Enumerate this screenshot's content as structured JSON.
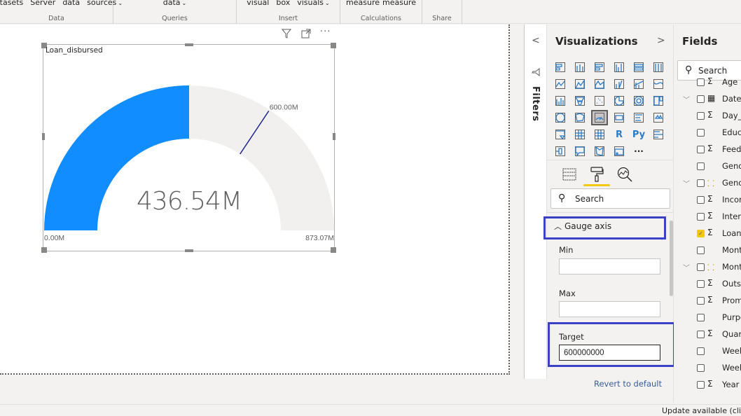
{
  "ribbon": {
    "groups": [
      {
        "label": "Data",
        "buttons": [
          "datasets",
          "Server",
          "data",
          "sources"
        ],
        "dropdown_last": true
      },
      {
        "label": "Queries",
        "buttons": [
          "data"
        ],
        "dropdown_last": true
      },
      {
        "label": "Insert",
        "buttons": [
          "visual",
          "box",
          "visuals"
        ],
        "dropdown_last": true
      },
      {
        "label": "Calculations",
        "buttons": [
          "measure",
          "measure"
        ],
        "dropdown_last": false
      },
      {
        "label": "Share",
        "buttons": [],
        "dropdown_last": false
      }
    ]
  },
  "visual": {
    "title": "Loan_disbursed",
    "header_icons": [
      "filter-icon",
      "focus-mode-icon",
      "more-options-icon"
    ]
  },
  "chart_data": {
    "type": "gauge",
    "title": "Loan_disbursed",
    "value": 436540000,
    "value_label": "436.54M",
    "min": 0,
    "min_label": "0.00M",
    "max": 873070000,
    "max_label": "873.07M",
    "target": 600000000,
    "target_label": "600.00M",
    "colors": {
      "fill": "#118dff",
      "track": "#f1f0ef",
      "target": "#1b2185"
    }
  },
  "filters_pane": {
    "label": "Filters",
    "collapse_glyph": "<"
  },
  "visualizations": {
    "title": "Visualizations",
    "expand_glyph": ">",
    "selected_index": 14,
    "icons": [
      "stacked-bar-chart-icon",
      "stacked-column-chart-icon",
      "clustered-bar-chart-icon",
      "clustered-column-chart-icon",
      "100-stacked-bar-chart-icon",
      "100-stacked-column-chart-icon",
      "line-chart-icon",
      "area-chart-icon",
      "stacked-area-chart-icon",
      "line-and-stacked-column-icon",
      "line-and-clustered-column-icon",
      "ribbon-chart-icon",
      "waterfall-chart-icon",
      "funnel-icon",
      "scatter-chart-icon",
      "pie-chart-icon",
      "donut-chart-icon",
      "treemap-icon",
      "map-icon",
      "filled-map-icon",
      "gauge-icon",
      "card-icon",
      "multi-row-card-icon",
      "kpi-icon",
      "slicer-icon",
      "table-icon",
      "matrix-icon",
      "r-script-visual-icon",
      "python-visual-icon",
      "key-influencers-icon",
      "decomposition-tree-icon",
      "qa-icon",
      "shape-map-icon",
      "arcgis-icon",
      "more-visuals-icon"
    ],
    "pane_tabs": [
      "fields-tab",
      "format-tab",
      "analytics-tab"
    ],
    "active_tab": "format-tab",
    "search_placeholder": "Search",
    "section": {
      "label": "Gauge axis",
      "expanded": true
    },
    "fields": [
      {
        "label": "Min",
        "value": ""
      },
      {
        "label": "Max",
        "value": ""
      },
      {
        "label": "Target",
        "value": "600000000"
      }
    ],
    "revert_label": "Revert to default",
    "highlight_color": "#3b41c5"
  },
  "fields_pane": {
    "title": "Fields",
    "search_placeholder": "Search",
    "items": [
      {
        "name": "Age",
        "type": "sigma",
        "expand": false,
        "checked": false
      },
      {
        "name": "Date",
        "type": "calendar",
        "expand": true,
        "checked": false
      },
      {
        "name": "Day_",
        "type": "sigma",
        "expand": false,
        "checked": false
      },
      {
        "name": "Educa",
        "type": "",
        "expand": false,
        "checked": false
      },
      {
        "name": "Feedl",
        "type": "sigma",
        "expand": false,
        "checked": false
      },
      {
        "name": "Gend",
        "type": "",
        "expand": false,
        "checked": false
      },
      {
        "name": "Gend",
        "type": "hierarchy",
        "expand": true,
        "checked": false
      },
      {
        "name": "Incor",
        "type": "sigma",
        "expand": false,
        "checked": false
      },
      {
        "name": "Intere",
        "type": "sigma",
        "expand": false,
        "checked": false
      },
      {
        "name": "Loan_",
        "type": "sigma",
        "expand": false,
        "checked": true
      },
      {
        "name": "Mont",
        "type": "",
        "expand": false,
        "checked": false
      },
      {
        "name": "Mont",
        "type": "hierarchy",
        "expand": true,
        "checked": false
      },
      {
        "name": "Outst",
        "type": "sigma",
        "expand": false,
        "checked": false
      },
      {
        "name": "Prom",
        "type": "sigma",
        "expand": false,
        "checked": false
      },
      {
        "name": "Purpo",
        "type": "",
        "expand": false,
        "checked": false
      },
      {
        "name": "Quar",
        "type": "sigma",
        "expand": false,
        "checked": false
      },
      {
        "name": "Week",
        "type": "",
        "expand": false,
        "checked": false
      },
      {
        "name": "Week",
        "type": "",
        "expand": false,
        "checked": false
      },
      {
        "name": "Year",
        "type": "sigma",
        "expand": false,
        "checked": false
      }
    ]
  },
  "status_bar": {
    "text": "Update available (clic"
  }
}
